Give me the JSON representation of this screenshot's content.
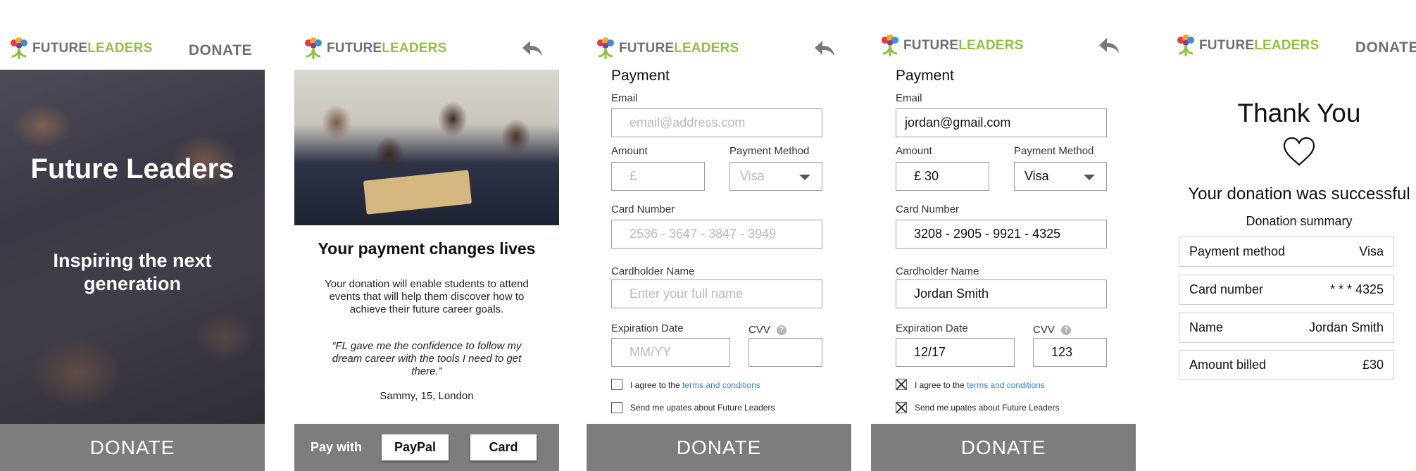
{
  "brand": {
    "future": "FUTURE",
    "leaders": "LEADERS",
    "green": "#8dc23f",
    "gray": "#707070"
  },
  "screen1": {
    "top_donate": "DONATE",
    "hero_title": "Future Leaders",
    "hero_subtitle": "Inspiring the next generation",
    "bottom_button": "DONATE"
  },
  "screen2": {
    "back_icon": "back-arrow-icon",
    "heading": "Your payment changes lives",
    "body": "Your donation will enable students to attend events that will help them discover how to achieve their future career goals.",
    "quote": "“FL gave me the confidence to follow my dream career with the tools I need to get there.”",
    "attribution": "Sammy, 15, London",
    "pay_with": "Pay with",
    "paypal_button": "PayPal",
    "card_button": "Card"
  },
  "screen3": {
    "title": "Payment",
    "email_label": "Email",
    "email_placeholder": "email@address.com",
    "amount_label": "Amount",
    "amount_placeholder": "£",
    "method_label": "Payment Method",
    "method_placeholder": "Visa",
    "card_label": "Card Number",
    "card_placeholder": "2536 - 3647 - 3847 - 3949",
    "name_label": "Cardholder Name",
    "name_placeholder": "Enter your full name",
    "exp_label": "Expiration Date",
    "exp_placeholder": "MM/YY",
    "cvv_label": "CVV",
    "help_glyph": "?",
    "agree_text": "I agree to the",
    "terms_link": "terms and conditions",
    "updates_text": "Send me upates about Future Leaders",
    "agree_checked": false,
    "updates_checked": false,
    "bottom_button": "DONATE"
  },
  "screen4": {
    "title": "Payment",
    "email_label": "Email",
    "email_value": "jordan@gmail.com",
    "amount_label": "Amount",
    "amount_value": "£ 30",
    "method_label": "Payment Method",
    "method_value": "Visa",
    "card_label": "Card Number",
    "card_value": "3208 - 2905 - 9921 - 4325",
    "name_label": "Cardholder Name",
    "name_value": "Jordan Smith",
    "exp_label": "Expiration Date",
    "exp_value": "12/17",
    "cvv_label": "CVV",
    "cvv_value": "123",
    "help_glyph": "?",
    "agree_text": "I agree to the",
    "terms_link": "terms and conditions",
    "updates_text": "Send me upates about Future Leaders",
    "agree_checked": true,
    "updates_checked": true,
    "bottom_button": "DONATE"
  },
  "screen5": {
    "top_donate": "DONATE",
    "thank_you": "Thank You",
    "heart_icon": "heart-icon",
    "success": "Your donation was successful",
    "summary_title": "Donation summary",
    "rows": [
      {
        "label": "Payment method",
        "value": "Visa"
      },
      {
        "label": "Card number",
        "value": "* * * 4325"
      },
      {
        "label": "Name",
        "value": "Jordan Smith"
      },
      {
        "label": "Amount billed",
        "value": "£30"
      }
    ]
  }
}
